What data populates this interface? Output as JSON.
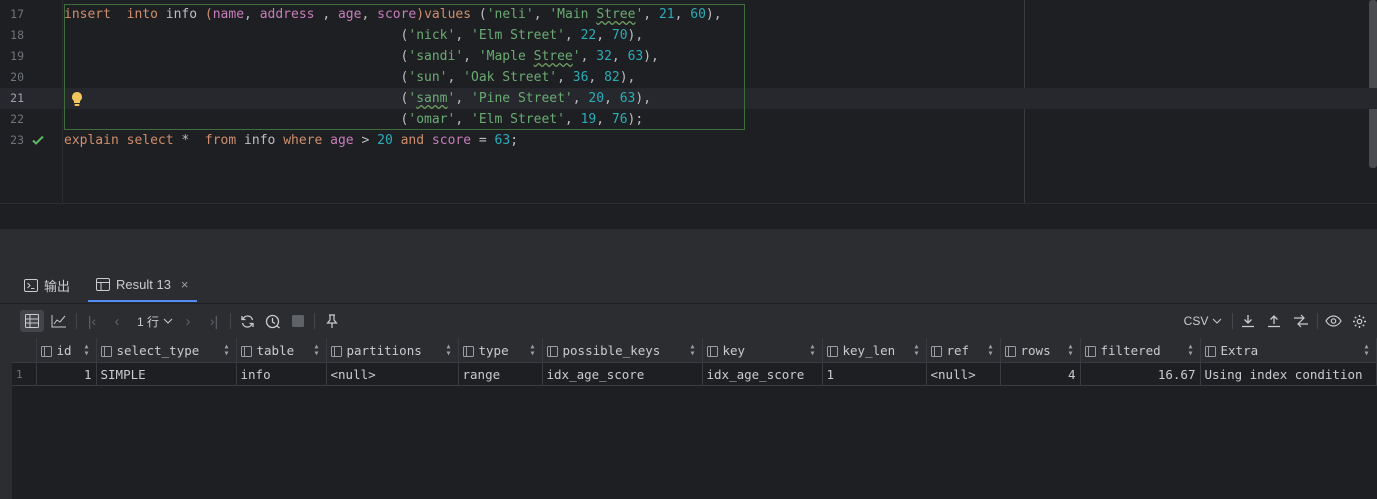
{
  "editor": {
    "lines": [
      {
        "num": "17",
        "tokens": [
          [
            "kw",
            "insert"
          ],
          [
            "",
            "  "
          ],
          [
            "kw",
            "into"
          ],
          [
            "",
            " info "
          ],
          [
            "kw",
            "("
          ],
          [
            "fld",
            "name"
          ],
          [
            " ",
            ", "
          ],
          [
            "fld",
            "address"
          ],
          [
            "",
            " , "
          ],
          [
            "fld",
            "age"
          ],
          [
            "",
            ", "
          ],
          [
            "fld",
            "score"
          ],
          [
            "kw",
            ")"
          ],
          [
            "kw",
            "values"
          ],
          [
            "",
            " ("
          ],
          [
            "str",
            "'neli'"
          ],
          [
            "",
            ", "
          ],
          [
            "str",
            "'Main "
          ],
          [
            "strt",
            "Stree"
          ],
          [
            "str",
            "'"
          ],
          [
            "",
            ", "
          ],
          [
            "num",
            "21"
          ],
          [
            "",
            ", "
          ],
          [
            "num",
            "60"
          ],
          [
            "",
            "),"
          ]
        ]
      },
      {
        "num": "18",
        "tokens": [
          [
            "",
            "                                           ("
          ],
          [
            "str",
            "'nick'"
          ],
          [
            "",
            ", "
          ],
          [
            "str",
            "'Elm Street'"
          ],
          [
            "",
            ", "
          ],
          [
            "num",
            "22"
          ],
          [
            "",
            ", "
          ],
          [
            "num",
            "70"
          ],
          [
            "",
            "),"
          ]
        ]
      },
      {
        "num": "19",
        "tokens": [
          [
            "",
            "                                           ("
          ],
          [
            "str",
            "'sandi'"
          ],
          [
            "",
            ", "
          ],
          [
            "str",
            "'Maple "
          ],
          [
            "strt",
            "Stree"
          ],
          [
            "str",
            "'"
          ],
          [
            "",
            ", "
          ],
          [
            "num",
            "32"
          ],
          [
            "",
            ", "
          ],
          [
            "num",
            "63"
          ],
          [
            "",
            "),"
          ]
        ]
      },
      {
        "num": "20",
        "tokens": [
          [
            "",
            "                                           ("
          ],
          [
            "str",
            "'sun'"
          ],
          [
            "",
            ", "
          ],
          [
            "str",
            "'Oak Street'"
          ],
          [
            "",
            ", "
          ],
          [
            "num",
            "36"
          ],
          [
            "",
            ", "
          ],
          [
            "num",
            "82"
          ],
          [
            "",
            "),"
          ]
        ]
      },
      {
        "num": "21",
        "tokens": [
          [
            "",
            "                                           ("
          ],
          [
            "str",
            "'"
          ],
          [
            "strt",
            "sanm"
          ],
          [
            "str",
            "'"
          ],
          [
            "",
            ", "
          ],
          [
            "str",
            "'Pine Street'"
          ],
          [
            "",
            ", "
          ],
          [
            "num",
            "20"
          ],
          [
            "",
            ", "
          ],
          [
            "num",
            "63"
          ],
          [
            "",
            "),"
          ]
        ]
      },
      {
        "num": "22",
        "tokens": [
          [
            "",
            "                                           ("
          ],
          [
            "str",
            "'omar'"
          ],
          [
            "",
            ", "
          ],
          [
            "str",
            "'Elm Street'"
          ],
          [
            "",
            ", "
          ],
          [
            "num",
            "19"
          ],
          [
            "",
            ", "
          ],
          [
            "num",
            "76"
          ],
          [
            "",
            ");"
          ]
        ]
      },
      {
        "num": "23",
        "tokens": [
          [
            "kw",
            "explain"
          ],
          [
            "",
            " "
          ],
          [
            "kw",
            "select"
          ],
          [
            "",
            " *  "
          ],
          [
            "kw",
            "from"
          ],
          [
            "",
            " info "
          ],
          [
            "kw",
            "where"
          ],
          [
            "",
            " "
          ],
          [
            "fld",
            "age"
          ],
          [
            "",
            " > "
          ],
          [
            "num",
            "20"
          ],
          [
            "",
            " "
          ],
          [
            "kw",
            "and"
          ],
          [
            "",
            " "
          ],
          [
            "fld",
            "score"
          ],
          [
            "",
            " = "
          ],
          [
            "num",
            "63"
          ],
          [
            "",
            ";"
          ]
        ]
      }
    ]
  },
  "tabs": [
    {
      "label": "输出",
      "icon": "console-icon"
    },
    {
      "label": "Result 13",
      "icon": "table-icon"
    }
  ],
  "toolbar": {
    "page_label": "1 行",
    "export_format": "CSV"
  },
  "grid": {
    "columns": [
      "id",
      "select_type",
      "table",
      "partitions",
      "type",
      "possible_keys",
      "key",
      "key_len",
      "ref",
      "rows",
      "filtered",
      "Extra"
    ],
    "rows": [
      {
        "rownum": "1",
        "cells": [
          "1",
          "SIMPLE",
          "info",
          "<null>",
          "range",
          "idx_age_score",
          "idx_age_score",
          "1",
          "<null>",
          "4",
          "16.67",
          "Using index condition"
        ]
      }
    ]
  },
  "colors": {
    "keyword": "#cf8e6d",
    "field": "#c77dbb",
    "string": "#6aab73",
    "number": "#2aacb8",
    "accent": "#548af7"
  }
}
